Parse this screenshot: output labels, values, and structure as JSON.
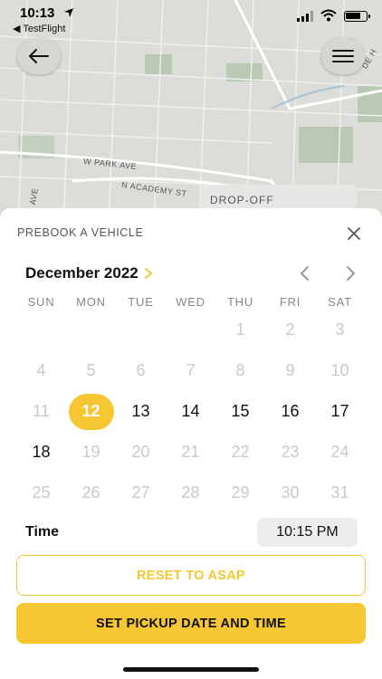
{
  "status_bar": {
    "time": "10:13",
    "back_app": "◀ TestFlight"
  },
  "map": {
    "street_1": "W PARK AVE",
    "street_2": "N ACADEMY ST",
    "street_3": "AVE",
    "street_4": "DE H",
    "dropoff_label": "DROP-OFF"
  },
  "sheet": {
    "title": "PREBOOK A VEHICLE",
    "month": "December 2022",
    "weekdays": [
      "SUN",
      "MON",
      "TUE",
      "WED",
      "THU",
      "FRI",
      "SAT"
    ],
    "days": [
      {
        "label": "",
        "state": "empty"
      },
      {
        "label": "",
        "state": "empty"
      },
      {
        "label": "",
        "state": "empty"
      },
      {
        "label": "",
        "state": "empty"
      },
      {
        "label": "1",
        "state": "disabled"
      },
      {
        "label": "2",
        "state": "disabled"
      },
      {
        "label": "3",
        "state": "disabled"
      },
      {
        "label": "4",
        "state": "disabled"
      },
      {
        "label": "5",
        "state": "disabled"
      },
      {
        "label": "6",
        "state": "disabled"
      },
      {
        "label": "7",
        "state": "disabled"
      },
      {
        "label": "8",
        "state": "disabled"
      },
      {
        "label": "9",
        "state": "disabled"
      },
      {
        "label": "10",
        "state": "disabled"
      },
      {
        "label": "11",
        "state": "disabled"
      },
      {
        "label": "12",
        "state": "selected"
      },
      {
        "label": "13",
        "state": "active"
      },
      {
        "label": "14",
        "state": "active"
      },
      {
        "label": "15",
        "state": "active"
      },
      {
        "label": "16",
        "state": "active"
      },
      {
        "label": "17",
        "state": "active"
      },
      {
        "label": "18",
        "state": "active"
      },
      {
        "label": "19",
        "state": "disabled"
      },
      {
        "label": "20",
        "state": "disabled"
      },
      {
        "label": "21",
        "state": "disabled"
      },
      {
        "label": "22",
        "state": "disabled"
      },
      {
        "label": "23",
        "state": "disabled"
      },
      {
        "label": "24",
        "state": "disabled"
      },
      {
        "label": "25",
        "state": "disabled"
      },
      {
        "label": "26",
        "state": "disabled"
      },
      {
        "label": "27",
        "state": "disabled"
      },
      {
        "label": "28",
        "state": "disabled"
      },
      {
        "label": "29",
        "state": "disabled"
      },
      {
        "label": "30",
        "state": "disabled"
      },
      {
        "label": "31",
        "state": "disabled"
      }
    ],
    "time_label": "Time",
    "time_value": "10:15 PM",
    "reset_label": "RESET TO ASAP",
    "set_label": "SET PICKUP DATE AND TIME"
  },
  "colors": {
    "accent": "#f7c633",
    "disabled_day": "#c9c9c9"
  },
  "icons": [
    "location-arrow-icon",
    "signal-icon",
    "wifi-icon",
    "battery-icon",
    "back-arrow-icon",
    "hamburger-menu-icon",
    "close-icon",
    "chevron-right-icon",
    "chevron-left-icon"
  ]
}
